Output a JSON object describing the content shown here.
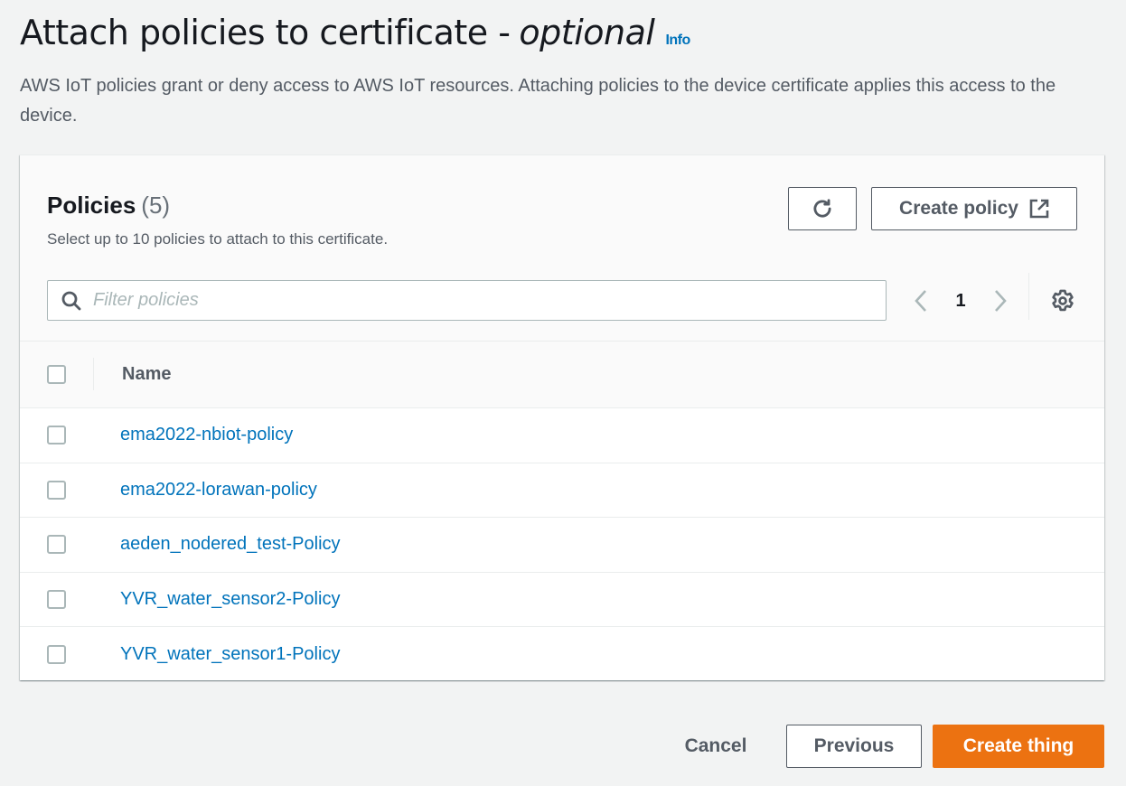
{
  "header": {
    "title": "Attach policies to certificate -",
    "title_emphasis": "optional",
    "info_link": "Info",
    "description": "AWS IoT policies grant or deny access to AWS IoT resources. Attaching policies to the device certificate applies this access to the device."
  },
  "policies_panel": {
    "title": "Policies",
    "count": "(5)",
    "subtitle": "Select up to 10 policies to attach to this certificate.",
    "refresh_icon": "refresh-icon",
    "create_policy_label": "Create policy",
    "create_policy_icon": "external-link-icon",
    "filter": {
      "placeholder": "Filter policies",
      "value": ""
    },
    "pagination": {
      "current_page": "1",
      "prev_icon": "chevron-left-icon",
      "next_icon": "chevron-right-icon"
    },
    "settings_icon": "gear-icon",
    "table": {
      "columns": [
        "Name"
      ],
      "rows": [
        {
          "name": "ema2022-nbiot-policy",
          "selected": false
        },
        {
          "name": "ema2022-lorawan-policy",
          "selected": false
        },
        {
          "name": "aeden_nodered_test-Policy",
          "selected": false
        },
        {
          "name": "YVR_water_sensor2-Policy",
          "selected": false
        },
        {
          "name": "YVR_water_sensor1-Policy",
          "selected": false
        }
      ]
    }
  },
  "footer": {
    "cancel_label": "Cancel",
    "previous_label": "Previous",
    "create_thing_label": "Create thing"
  },
  "colors": {
    "primary_button": "#ec7211",
    "link": "#0073bb",
    "background": "#f2f3f3"
  }
}
